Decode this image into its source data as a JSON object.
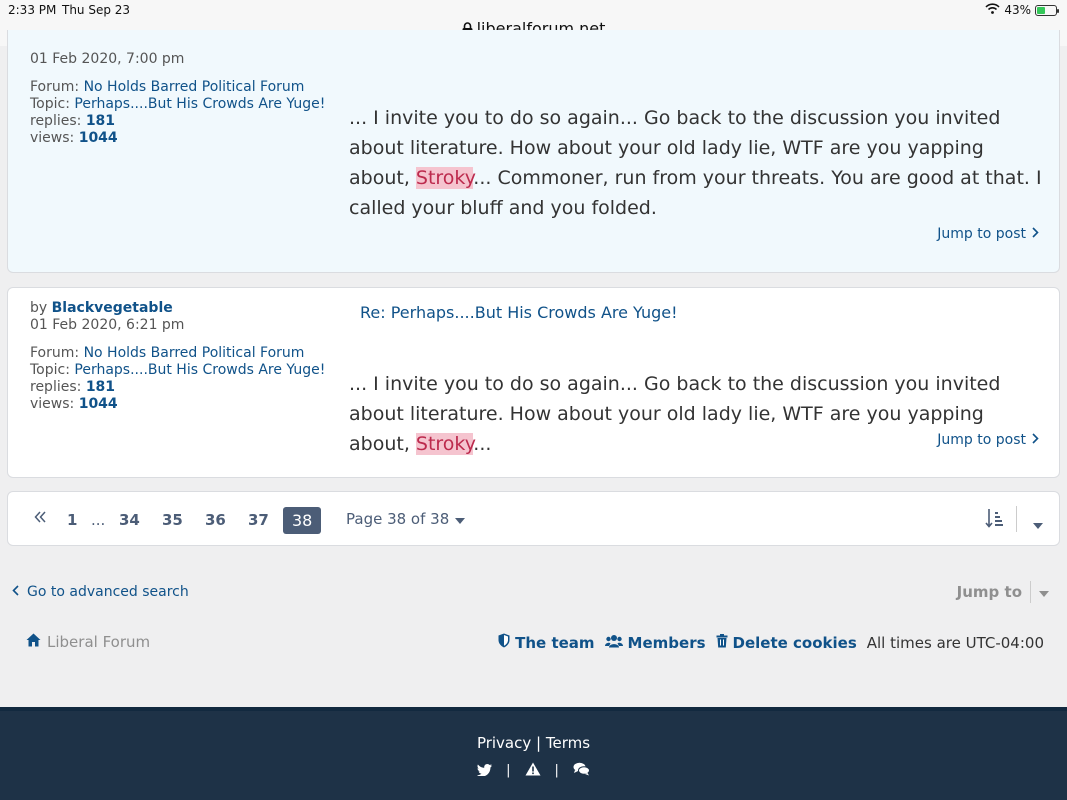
{
  "status_bar": {
    "time": "2:33 PM",
    "date": "Thu Sep 23",
    "url": "liberalforum.net",
    "battery": "43%",
    "battery_level": 0.43
  },
  "posts": [
    {
      "date": "01 Feb 2020, 7:00 pm",
      "forum_label": "Forum:",
      "forum": "No Holds Barred Political Forum",
      "topic_label": "Topic:",
      "topic": "Perhaps....But His Crowds Are Yuge!",
      "replies_label": "replies:",
      "replies": "181",
      "views_label": "views:",
      "views": "1044",
      "body_pre": "... I invite you to do so again... Go back to the discussion you invited about literature. How about your old lady lie, WTF are you yapping about, ",
      "body_highlight": "Stroky",
      "body_post": "... Commoner, run from your threats. You are good at that. I called your bluff and you folded.",
      "jump": "Jump to post"
    },
    {
      "by_label": "by",
      "author": "Blackvegetable",
      "date": "01 Feb 2020, 6:21 pm",
      "title": "Re: Perhaps....But His Crowds Are Yuge!",
      "forum_label": "Forum:",
      "forum": "No Holds Barred Political Forum",
      "topic_label": "Topic:",
      "topic": "Perhaps....But His Crowds Are Yuge!",
      "replies_label": "replies:",
      "replies": "181",
      "views_label": "views:",
      "views": "1044",
      "body_pre": "... I invite you to do so again... Go back to the discussion you invited about literature. How about your old lady lie, WTF are you yapping about, ",
      "body_highlight": "Stroky",
      "body_post": "...",
      "jump": "Jump to post"
    }
  ],
  "pagination": {
    "first": "1",
    "ellipsis": "...",
    "pages": [
      "34",
      "35",
      "36",
      "37"
    ],
    "current": "38",
    "label": "Page 38 of 38"
  },
  "advanced_search": "Go to advanced search",
  "jump_to": "Jump to",
  "nav": {
    "home": "Liberal Forum",
    "team": "The team",
    "members": "Members",
    "delete_cookies": "Delete cookies",
    "timezone": "All times are UTC-04:00"
  },
  "footer": {
    "privacy": "Privacy",
    "separator": "|",
    "terms": "Terms"
  },
  "colors": {
    "link": "#105289",
    "highlight_bg": "#f5c4cf",
    "highlight_text": "#bc2a4d",
    "footer_bg": "#1e3247",
    "pager_active": "#4c5d77"
  }
}
